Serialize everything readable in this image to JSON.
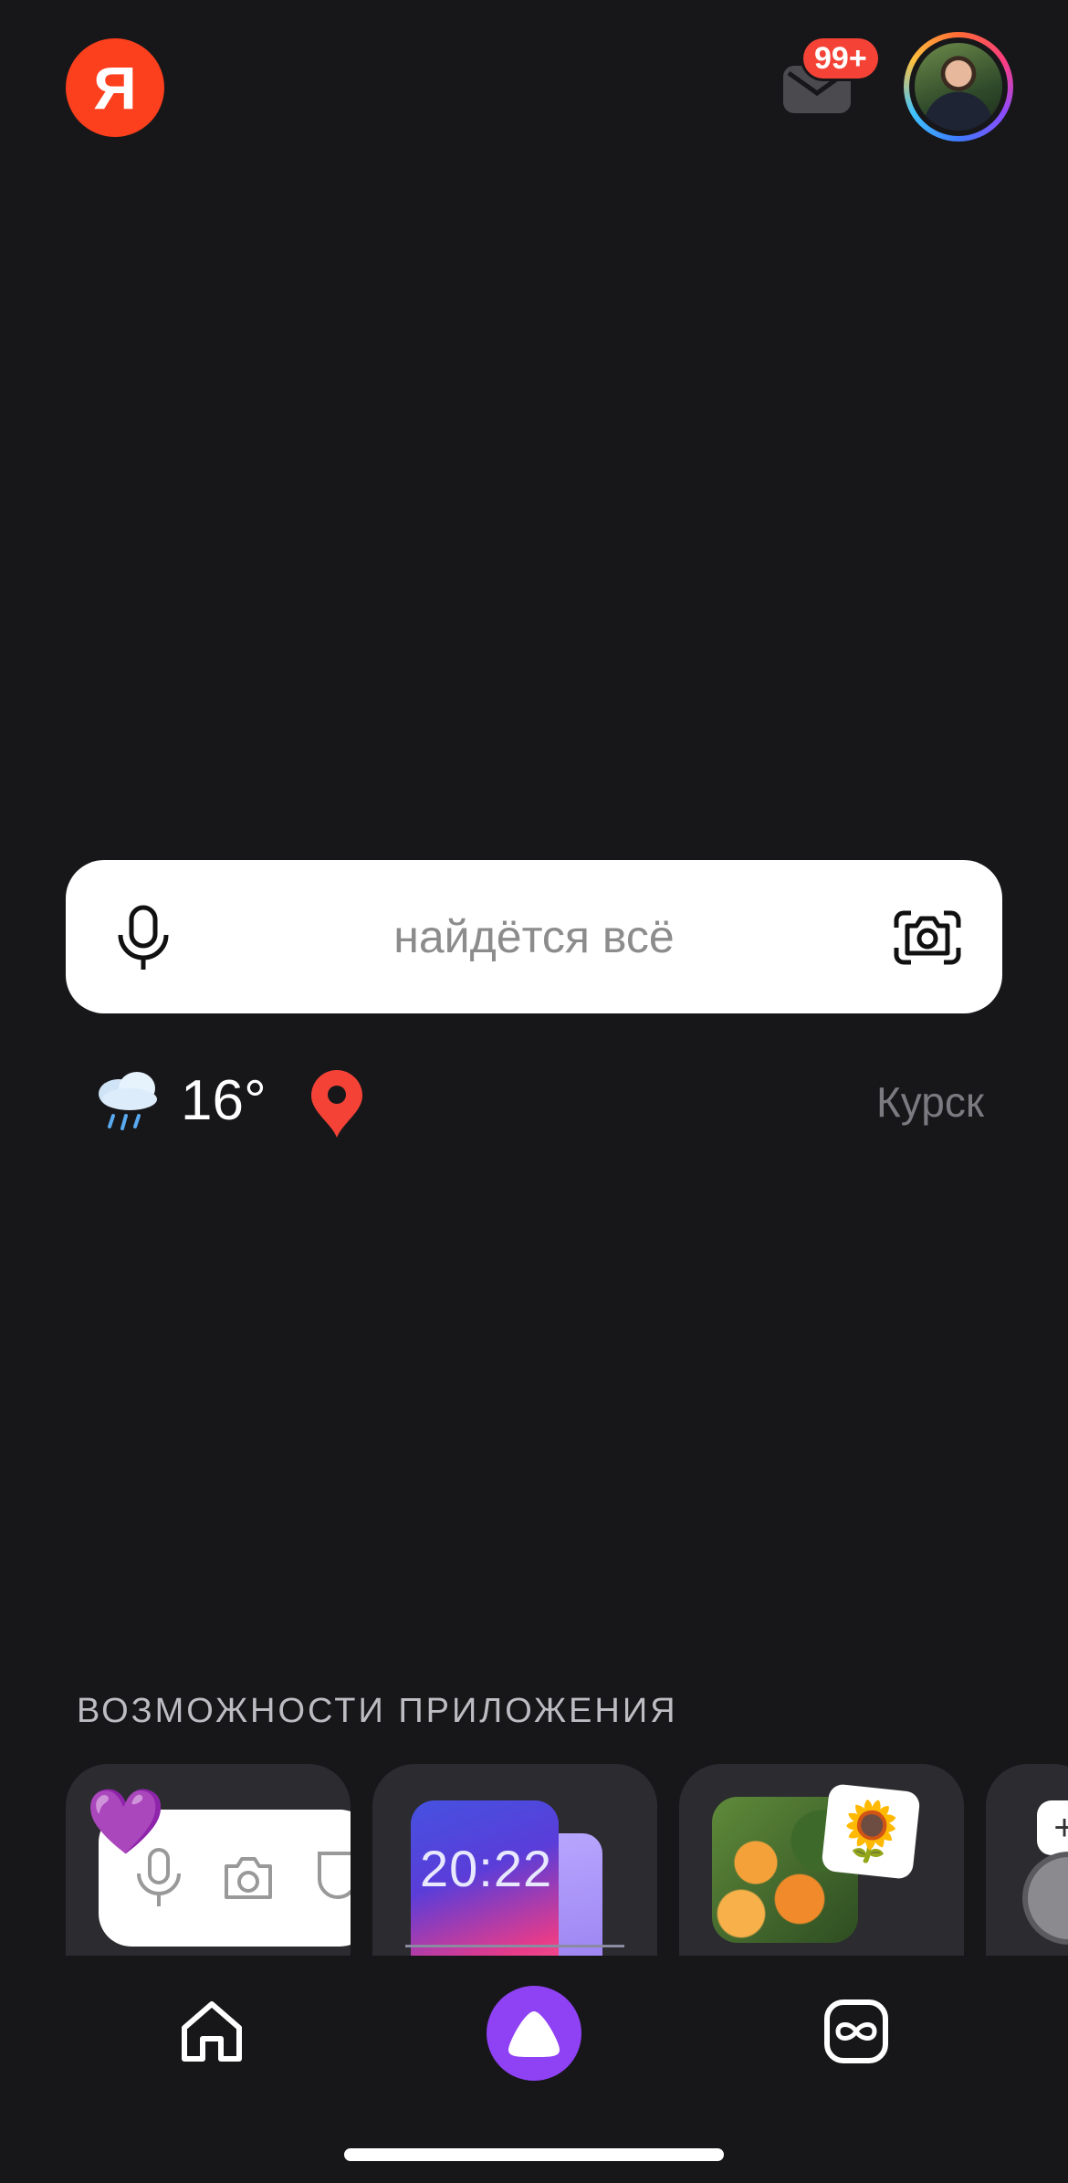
{
  "header": {
    "logo_letter": "Я",
    "mail_badge": "99+",
    "avatar_alt": "profile"
  },
  "search": {
    "placeholder": "найдётся всё",
    "mic_icon": "microphone-icon",
    "camera_icon": "camera-icon"
  },
  "weather": {
    "icon": "rain-cloud-icon",
    "temperature": "16°",
    "location_icon": "map-pin-icon",
    "city": "Курск"
  },
  "features": {
    "title": "ВОЗМОЖНОСТИ ПРИЛОЖЕНИЯ",
    "cards": [
      {
        "name": "voice-and-camera-search"
      },
      {
        "name": "widgets",
        "time": "20:22"
      },
      {
        "name": "image-search"
      },
      {
        "name": "more"
      }
    ]
  },
  "tabbar": {
    "items": [
      {
        "name": "home",
        "icon": "home-icon"
      },
      {
        "name": "alice",
        "icon": "alice-icon"
      },
      {
        "name": "services",
        "icon": "services-icon"
      }
    ]
  },
  "colors": {
    "background": "#17171a",
    "logo": "#fc3f1d",
    "alice": "#8f41f4",
    "badge": "#f44336"
  }
}
